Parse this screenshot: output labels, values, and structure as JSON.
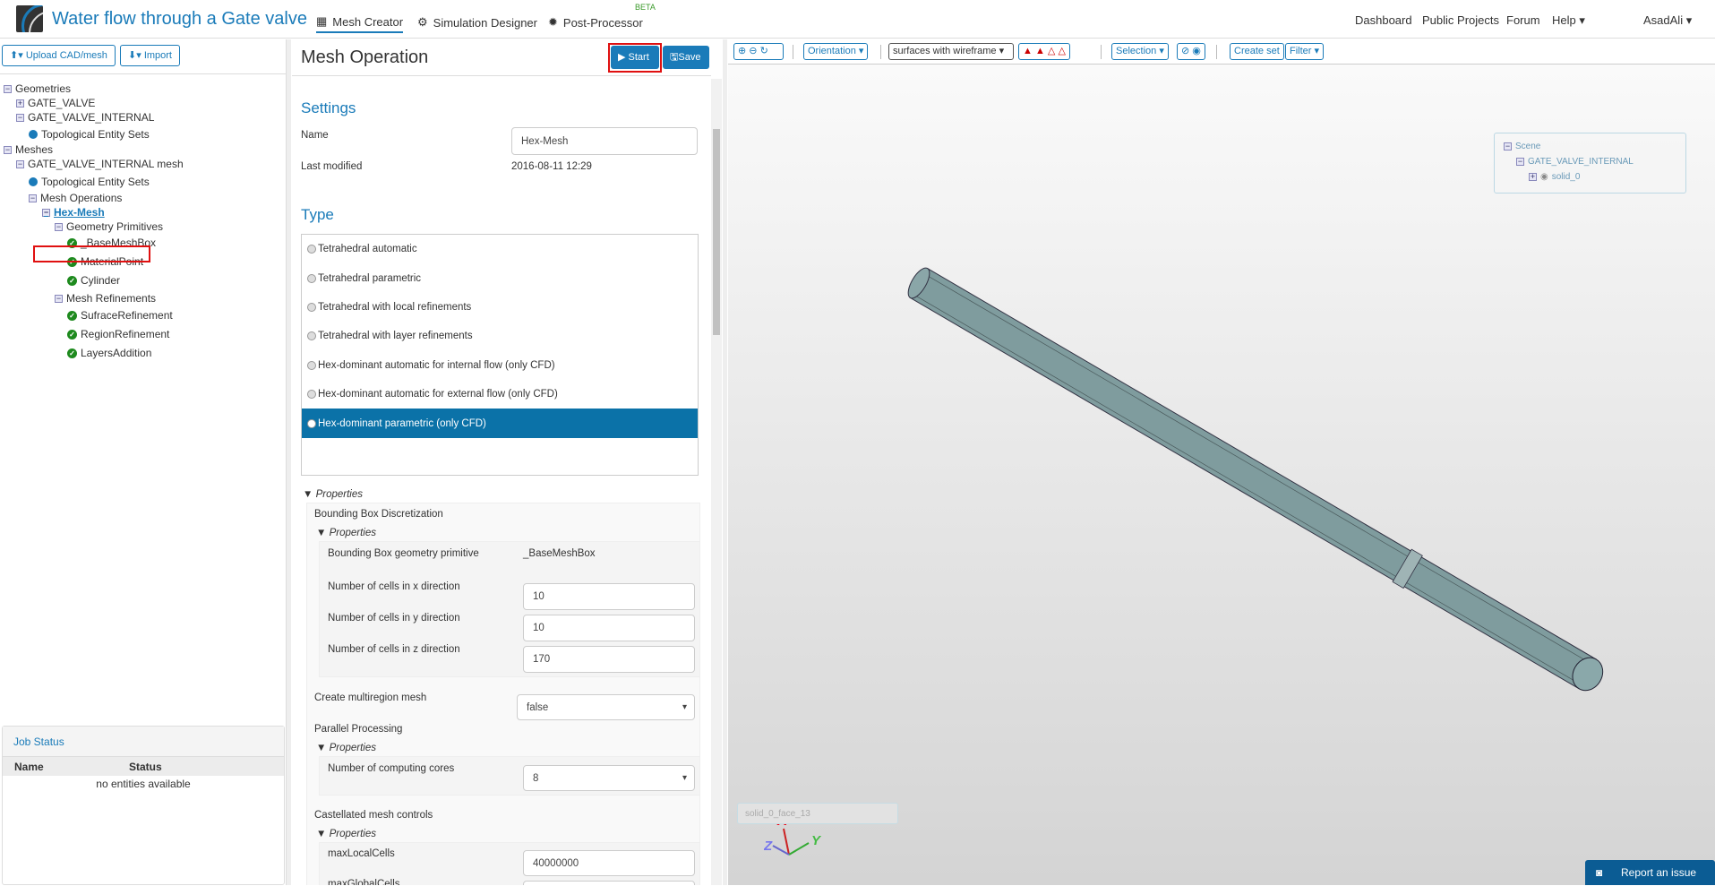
{
  "header": {
    "project_title": "Water flow through a Gate valve",
    "tabs": [
      {
        "label": "Mesh Creator",
        "icon": "grid-icon"
      },
      {
        "label": "Simulation Designer",
        "icon": "gears-icon"
      },
      {
        "label": "Post-Processor",
        "icon": "cog-icon",
        "badge": "BETA"
      }
    ],
    "nav": [
      "Dashboard",
      "Public Projects",
      "Forum",
      "Help"
    ],
    "user": "AsadAli"
  },
  "left": {
    "upload_label": "Upload CAD/mesh",
    "import_label": "Import",
    "tree": [
      "Geometries",
      "GATE_VALVE",
      "GATE_VALVE_INTERNAL",
      "Topological Entity Sets",
      "Meshes",
      "GATE_VALVE_INTERNAL mesh",
      "Topological Entity Sets",
      "Mesh Operations",
      "Hex-Mesh",
      "Geometry Primitives",
      "_BaseMeshBox",
      "MaterialPoint",
      "Cylinder",
      "Mesh Refinements",
      "SufraceRefinement",
      "RegionRefinement",
      "LayersAddition"
    ],
    "job_status": {
      "title": "Job Status",
      "columns": [
        "Name",
        "Status"
      ],
      "empty": "no entities available"
    }
  },
  "mesh_operation": {
    "title": "Mesh Operation",
    "start_label": "Start",
    "save_label": "Save",
    "settings_heading": "Settings",
    "name_label": "Name",
    "name_value": "Hex-Mesh",
    "last_modified_label": "Last modified",
    "last_modified_value": "2016-08-11 12:29",
    "type_heading": "Type",
    "types": [
      "Tetrahedral automatic",
      "Tetrahedral parametric",
      "Tetrahedral with local refinements",
      "Tetrahedral with layer refinements",
      "Hex-dominant automatic for internal flow (only CFD)",
      "Hex-dominant automatic for external flow (only CFD)",
      "Hex-dominant parametric (only CFD)"
    ],
    "selected_type": "Hex-dominant parametric (only CFD)",
    "properties_label": "Properties",
    "bbox": {
      "title": "Bounding Box Discretization",
      "primitive_label": "Bounding Box geometry primitive",
      "primitive_value": "_BaseMeshBox",
      "x_label": "Number of cells in x direction",
      "x_value": "10",
      "y_label": "Number of cells in y direction",
      "y_value": "10",
      "z_label": "Number of cells in z direction",
      "z_value": "170"
    },
    "multiregion_label": "Create multiregion mesh",
    "multiregion_value": "false",
    "parallel": {
      "title": "Parallel Processing",
      "cores_label": "Number of computing cores",
      "cores_value": "8"
    },
    "castellated": {
      "title": "Castellated mesh controls",
      "max_local_label": "maxLocalCells",
      "max_local_value": "40000000",
      "max_global_label": "maxGlobalCells"
    }
  },
  "viewer": {
    "orientation_label": "Orientation",
    "render_mode": "surfaces with wireframe",
    "selection_label": "Selection",
    "create_set_label": "Create set",
    "filter_label": "Filter",
    "scene_tree": [
      "Scene",
      "GATE_VALVE_INTERNAL",
      "solid_0"
    ],
    "axes": [
      "X",
      "Y",
      "Z"
    ],
    "selected_face": "solid_0_face_13",
    "report_label": "Report an issue"
  }
}
